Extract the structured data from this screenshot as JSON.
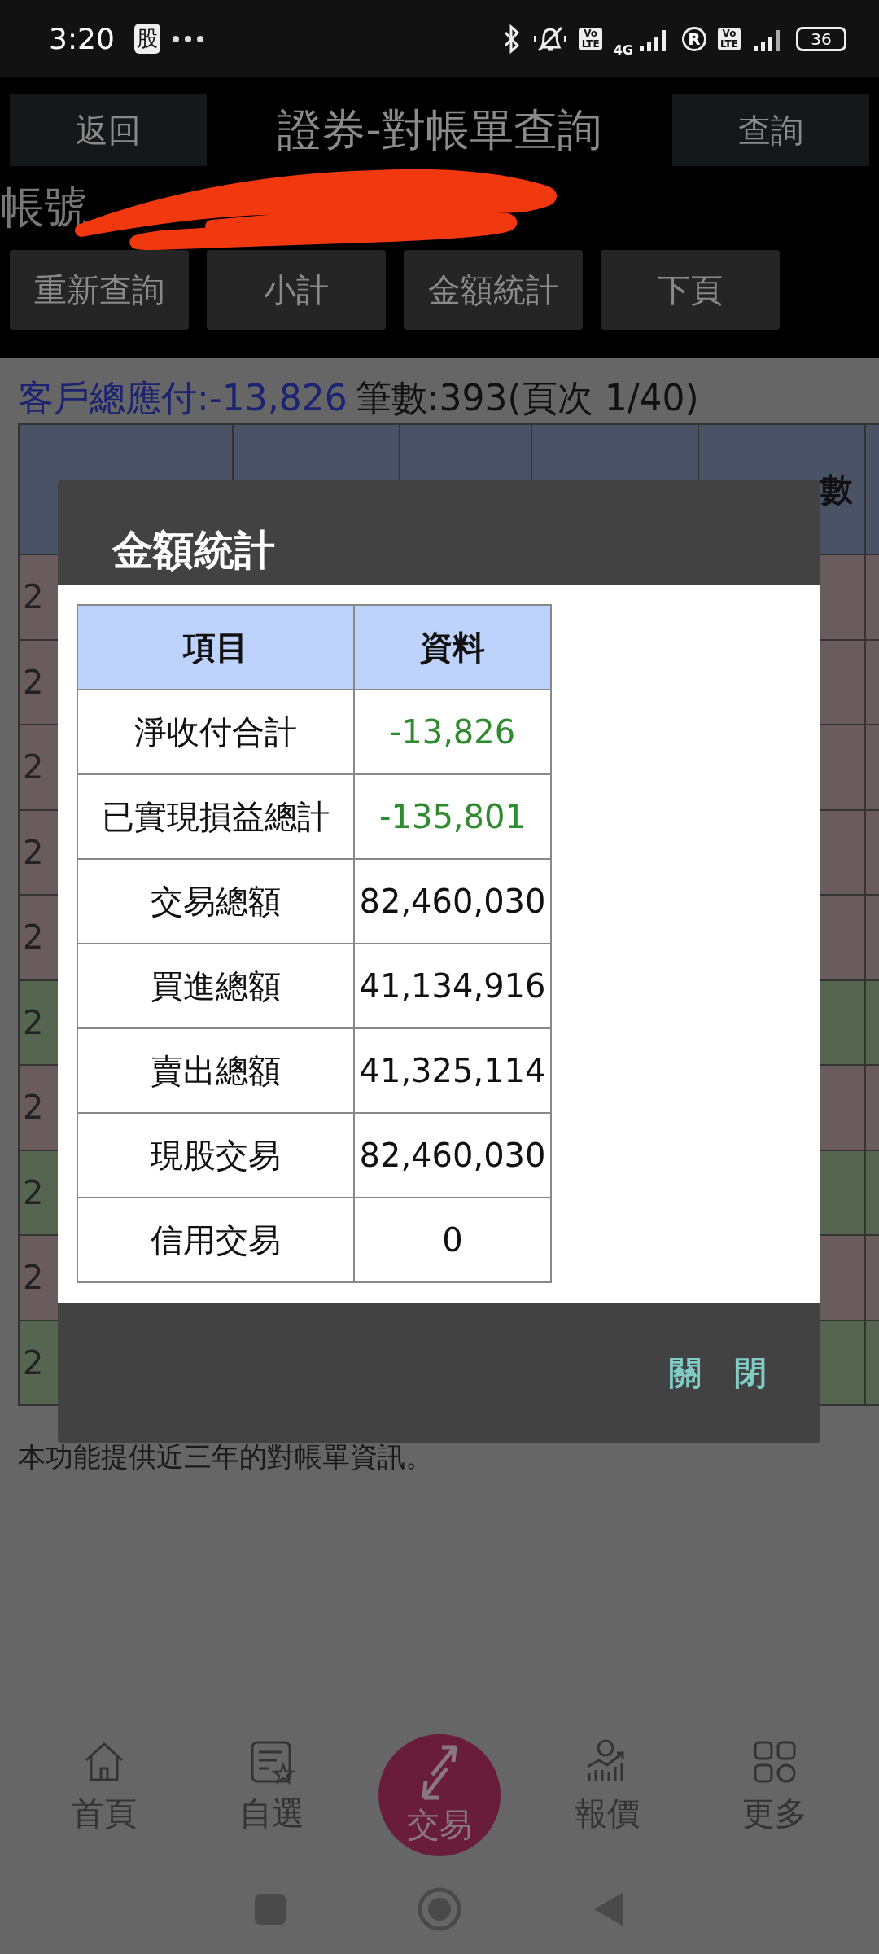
{
  "status_bar": {
    "time": "3:20",
    "app_badge": "股",
    "volte_labels": [
      {
        "top": "Vo",
        "bottom": "LTE"
      },
      {
        "top": "Vo",
        "bottom": "LTE"
      }
    ],
    "network": "4G",
    "roaming": "R",
    "battery": "36"
  },
  "header": {
    "back_button": "返回",
    "title": "證券-對帳單查詢",
    "query_button": "查詢"
  },
  "account": {
    "label": "帳號"
  },
  "actions": [
    "重新查詢",
    "小計",
    "金額統計",
    "下頁"
  ],
  "summary": {
    "payable": "客戶總應付:-13,826",
    "count": "筆數:393(頁次 1/40)"
  },
  "table": {
    "header_column_5": "數",
    "rows": [
      {
        "column_1": "2",
        "color": "#6a5c5c"
      },
      {
        "column_1": "2",
        "color": "#6a5c5c"
      },
      {
        "column_1": "2",
        "color": "#6a5c5c"
      },
      {
        "column_1": "2",
        "color": "#6a5c5c"
      },
      {
        "column_1": "2",
        "color": "#6a5c5c"
      },
      {
        "column_1": "2",
        "color": "#56654f"
      },
      {
        "column_1": "2",
        "color": "#6a5c5c"
      },
      {
        "column_1": "2",
        "color": "#56654f"
      },
      {
        "column_1": "2",
        "color": "#6a5c5c"
      },
      {
        "column_1": "2",
        "color": "#56654f"
      }
    ]
  },
  "note": "本功能提供近三年的對帳單資訊。",
  "dialog": {
    "title": "金額統計",
    "columns": [
      "項目",
      "資料"
    ],
    "rows": [
      {
        "item": "淨收付合計",
        "value": "-13,826",
        "color": "#2e8b2e"
      },
      {
        "item": "已實現損益總計",
        "value": "-135,801",
        "color": "#2e8b2e"
      },
      {
        "item": "交易總額",
        "value": "82,460,030",
        "color": "#111111"
      },
      {
        "item": "買進總額",
        "value": "41,134,916",
        "color": "#111111"
      },
      {
        "item": "賣出總額",
        "value": "41,325,114",
        "color": "#111111"
      },
      {
        "item": "現股交易",
        "value": "82,460,030",
        "color": "#111111"
      },
      {
        "item": "信用交易",
        "value": "0",
        "color": "#111111"
      }
    ],
    "close_button": "關　閉"
  },
  "bottom_nav": [
    {
      "label": "首頁",
      "kind": "tab"
    },
    {
      "label": "自選",
      "kind": "tab"
    },
    {
      "label": "交易",
      "kind": "center"
    },
    {
      "label": "報價",
      "kind": "tab"
    },
    {
      "label": "更多",
      "kind": "tab"
    }
  ]
}
